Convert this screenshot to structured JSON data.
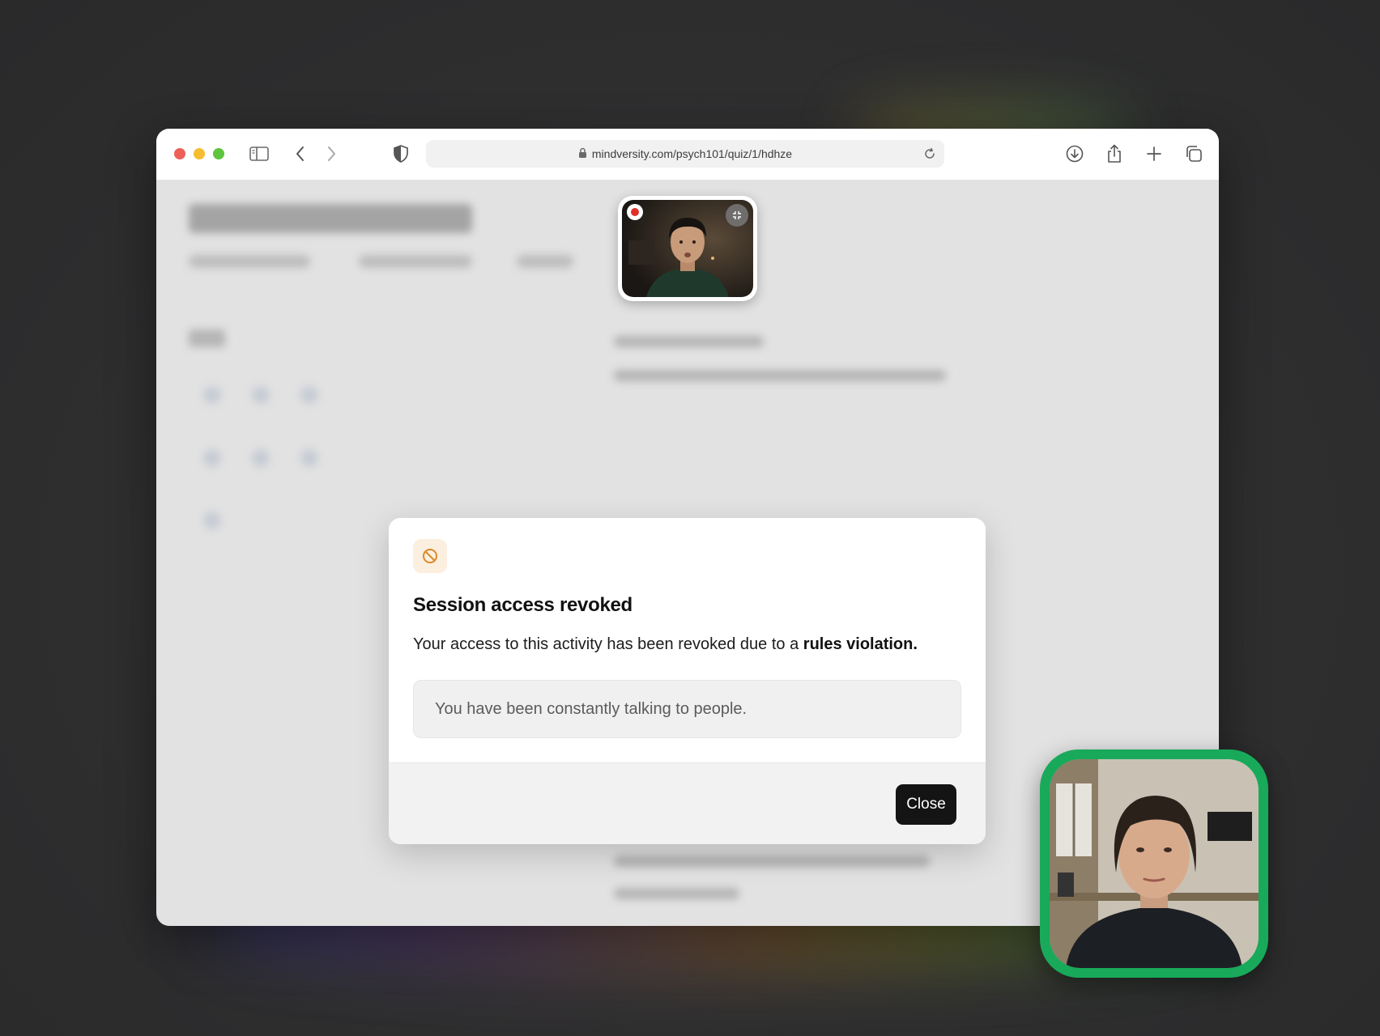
{
  "browser": {
    "url": "mindversity.com/psych101/quiz/1/hdhze",
    "traffic_lights": {
      "close": "#ee5f57",
      "minimize": "#f5bd2f",
      "maximize": "#5fc43f"
    },
    "toolbar_icons": [
      "sidebar-icon",
      "back-icon",
      "forward-icon",
      "shield-icon",
      "lock-icon",
      "reload-icon",
      "download-icon",
      "share-icon",
      "plus-icon",
      "tabs-icon"
    ]
  },
  "modal": {
    "icon": "prohibited-icon",
    "icon_color": "#d98a2a",
    "title": "Session access revoked",
    "message_prefix": "Your access to this activity has been revoked due to a ",
    "message_emphasis": "rules violation.",
    "reason": "You have been constantly talking to people.",
    "close_label": "Close"
  },
  "proctor_camera": {
    "recording_indicator": "recording-dot-icon",
    "collapse_icon": "collapse-icon"
  },
  "user_camera": {
    "border_color": "#19a95a"
  }
}
